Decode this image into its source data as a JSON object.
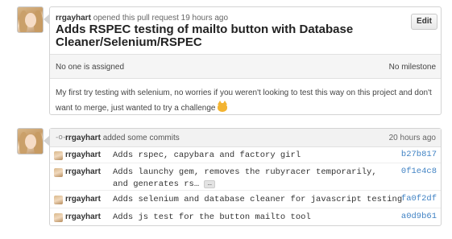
{
  "pull_request": {
    "author": "rrgayhart",
    "meta_text": "opened this pull request 19 hours ago",
    "title": "Adds RSPEC testing of mailto button with Database Cleaner/Selenium/RSPEC",
    "edit_label": "Edit",
    "assignee_text": "No one is assigned",
    "milestone_text": "No milestone",
    "body_text": "My first try testing with selenium, no worries if you weren't looking to test this way on this project and don't want to merge, just wanted to try a challenge",
    "emoji_icon": "smiley-cat-icon"
  },
  "commits_event": {
    "actor": "rrgayhart",
    "action_text": "added some commits",
    "time": "20 hours ago",
    "commits": [
      {
        "author": "rrgayhart",
        "message": "Adds rspec, capybara and factory girl",
        "sha": "b27b817"
      },
      {
        "author": "rrgayhart",
        "message": "Adds launchy gem, removes the rubyracer temporarily, and generates rs…",
        "expand_label": "…",
        "sha": "0f1e4c8"
      },
      {
        "author": "rrgayhart",
        "message": "Adds selenium and database cleaner for javascript testing",
        "sha": "fa0f2df"
      },
      {
        "author": "rrgayhart",
        "message": "Adds js test for the button mailto tool",
        "sha": "a0d9b61"
      }
    ]
  },
  "colors": {
    "link": "#4183c4",
    "header_bg": "#f5f5f5",
    "border": "#d3d3d3"
  }
}
